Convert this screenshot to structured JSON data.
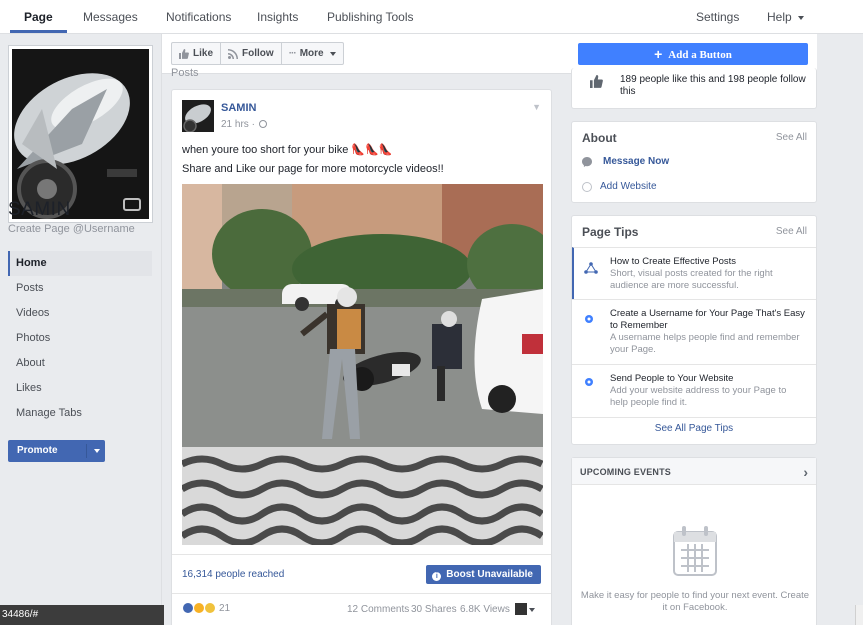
{
  "topnav": {
    "tabs": [
      "Page",
      "Messages",
      "Notifications",
      "Insights",
      "Publishing Tools"
    ],
    "settings": "Settings",
    "help": "Help"
  },
  "page": {
    "name": "SAMIN",
    "username_prompt": "Create Page @Username"
  },
  "leftnav": {
    "items": [
      "Home",
      "Posts",
      "Videos",
      "Photos",
      "About",
      "Likes",
      "Manage Tabs"
    ],
    "promote": "Promote"
  },
  "actionbar": {
    "like": "Like",
    "follow": "Follow",
    "more": "More",
    "add_button": "Add a Button"
  },
  "posts_label": "Posts",
  "post": {
    "author": "SAMIN",
    "time": "21 hrs ·",
    "text1": "when youre too short for your bike",
    "text2": "Share and Like our page for more motorcycle videos!!",
    "reached": "16,314 people reached",
    "boost": "Boost Unavailable",
    "reaction_count": "21",
    "comments": "12 Comments",
    "shares": "30 Shares",
    "views": "6.8K Views"
  },
  "likes_card": {
    "text": "189 people like this and 198 people follow this"
  },
  "about": {
    "title": "About",
    "see_all": "See All",
    "message_now": "Message Now",
    "add_website": "Add Website"
  },
  "tips": {
    "title": "Page Tips",
    "see_all": "See All",
    "items": [
      {
        "title": "How to Create Effective Posts",
        "desc": "Short, visual posts created for the right audience are more successful."
      },
      {
        "title": "Create a Username for Your Page That's Easy to Remember",
        "desc": "A username helps people find and remember your Page."
      },
      {
        "title": "Send People to Your Website",
        "desc": "Add your website address to your Page to help people find it."
      }
    ],
    "see_all_tips": "See All Page Tips"
  },
  "events": {
    "title": "UPCOMING EVENTS",
    "desc": "Make it easy for people to find your next event. Create it on Facebook."
  },
  "statusbar": "34486/#",
  "colors": {
    "brand": "#4267b2",
    "accent": "#4080ff",
    "link": "#365899",
    "background": "#e9ebee"
  }
}
